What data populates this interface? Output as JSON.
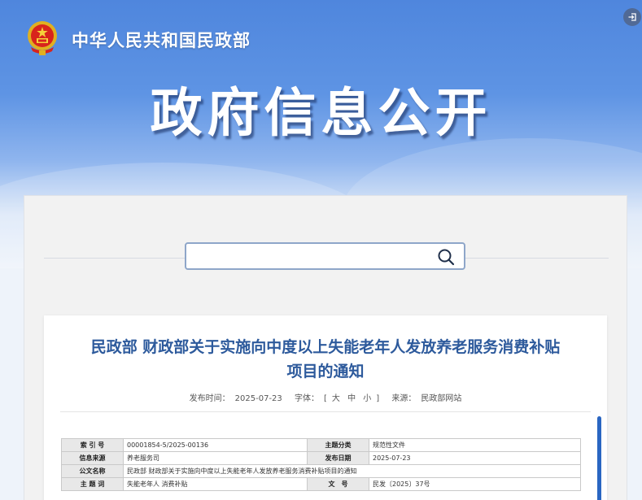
{
  "header": {
    "site_name": "中华人民共和国民政部",
    "hero_title": "政府信息公开",
    "emblem_icon": "national-emblem-icon",
    "login_icon": "login-icon"
  },
  "search": {
    "placeholder": "",
    "icon": "search-icon"
  },
  "document": {
    "title_line1": "民政部 财政部关于实施向中度以上失能老年人发放养老服务消费补贴",
    "title_line2": "项目的通知",
    "publish_label": "发布时间：",
    "publish_date": "2025-07-23",
    "font_label": "字体：",
    "font_open": "[",
    "font_large": "大",
    "font_medium": "中",
    "font_small": "小",
    "font_close": "]",
    "source_label": "来源：",
    "source_value": "民政部网站"
  },
  "info_table": {
    "index_label": "索 引 号",
    "index_value": "00001854-5/2025-00136",
    "category_label": "主题分类",
    "category_value": "规范性文件",
    "origin_label": "信息来源",
    "origin_value": "养老服务司",
    "date_label": "发布日期",
    "date_value": "2025-07-23",
    "name_label": "公文名称",
    "name_value": "民政部 财政部关于实施向中度以上失能老年人发放养老服务消费补贴项目的通知",
    "keywords_label": "主 题 词",
    "keywords_value": "失能老年人 消费补贴",
    "docno_label": "文　号",
    "docno_value": "民发〔2025〕37号"
  },
  "colors": {
    "title_blue": "#2d5a9c",
    "accent": "#2a66c2"
  }
}
